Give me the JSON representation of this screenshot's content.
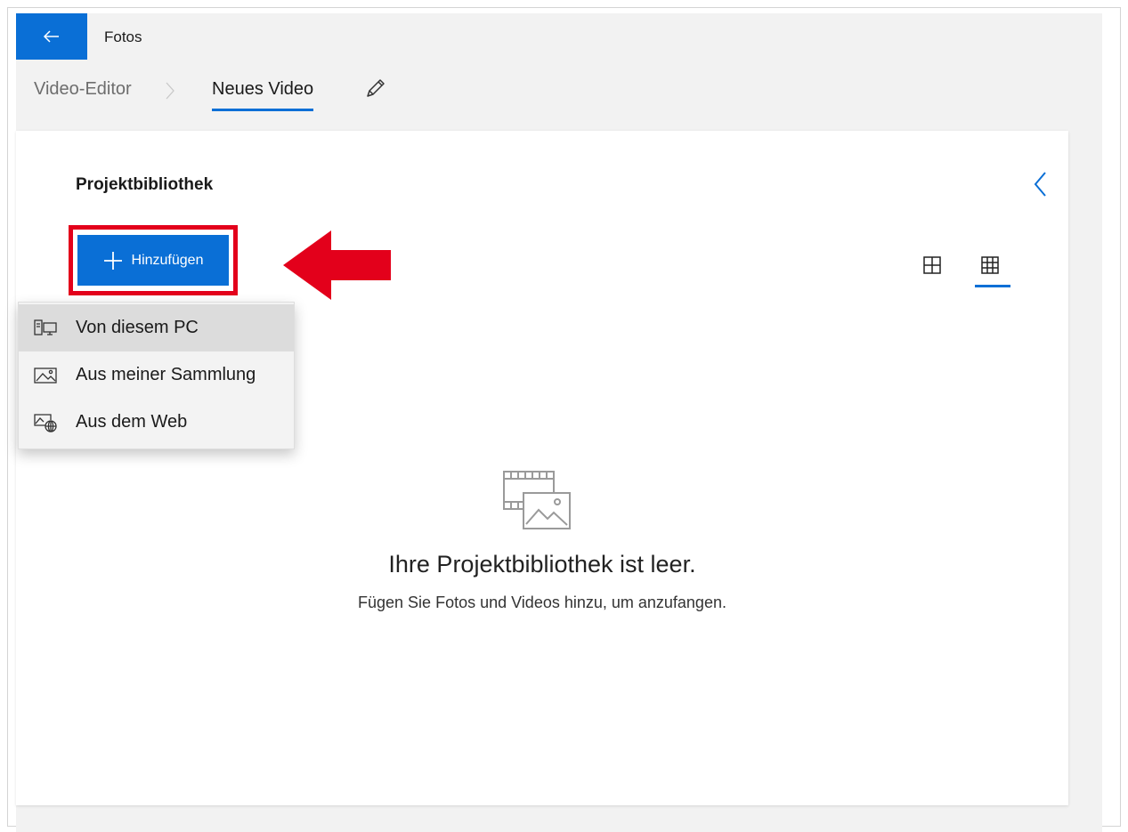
{
  "window": {
    "app_title": "Fotos",
    "back_icon": "arrow-left-icon"
  },
  "breadcrumb": {
    "parent": "Video-Editor",
    "current": "Neues Video",
    "edit_icon": "pencil-icon"
  },
  "library": {
    "title": "Projektbibliothek",
    "add_button_label": "Hinzufügen",
    "collapse_icon": "chevron-left-icon",
    "view_options": [
      "large-grid-icon",
      "small-grid-icon"
    ],
    "selected_view": "small-grid-icon",
    "empty_title": "Ihre Projektbibliothek ist leer.",
    "empty_subtitle": "Fügen Sie Fotos und Videos hinzu, um anzufangen.",
    "empty_icon": "media-placeholder-icon"
  },
  "add_menu": {
    "items": [
      {
        "label": "Von diesem PC",
        "icon": "computer-icon",
        "selected": true
      },
      {
        "label": "Aus meiner Sammlung",
        "icon": "image-icon",
        "selected": false
      },
      {
        "label": "Aus dem Web",
        "icon": "web-image-icon",
        "selected": false
      }
    ]
  },
  "annotation": {
    "highlight_color": "#e3001b",
    "arrow_color": "#e3001b"
  },
  "colors": {
    "accent": "#0a6fd6",
    "background": "#f2f2f2",
    "panel": "#ffffff"
  }
}
